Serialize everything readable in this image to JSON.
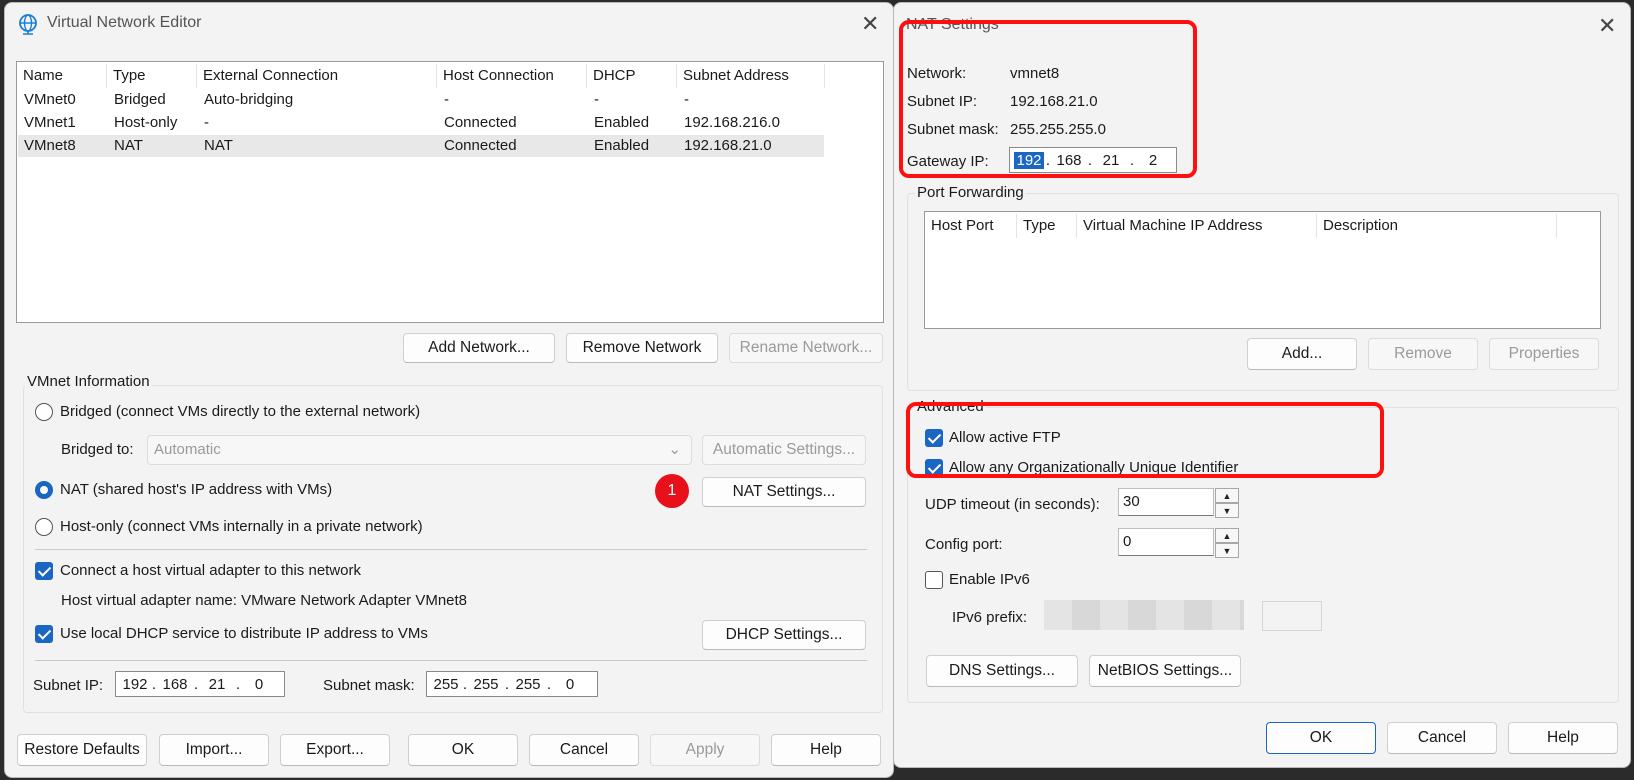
{
  "vne": {
    "title": "Virtual Network Editor",
    "columns": [
      "Name",
      "Type",
      "External Connection",
      "Host Connection",
      "DHCP",
      "Subnet Address"
    ],
    "rows": [
      [
        "VMnet0",
        "Bridged",
        "Auto-bridging",
        "-",
        "-",
        "-"
      ],
      [
        "VMnet1",
        "Host-only",
        "-",
        "Connected",
        "Enabled",
        "192.168.216.0"
      ],
      [
        "VMnet8",
        "NAT",
        "NAT",
        "Connected",
        "Enabled",
        "192.168.21.0"
      ]
    ],
    "add_network": "Add Network...",
    "remove_network": "Remove Network",
    "rename_network": "Rename Network...",
    "vmnet_info": "VMnet Information",
    "bridged_radio": "Bridged (connect VMs directly to the external network)",
    "bridged_to_label": "Bridged to:",
    "bridged_to_value": "Automatic",
    "automatic_settings": "Automatic Settings...",
    "nat_radio": "NAT (shared host's IP address with VMs)",
    "step_badge": "1",
    "nat_settings": "NAT Settings...",
    "hostonly_radio": "Host-only (connect VMs internally in a private network)",
    "connect_adapter": "Connect a host virtual adapter to this network",
    "adapter_name": "Host virtual adapter name: VMware Network Adapter VMnet8",
    "use_dhcp": "Use local DHCP service to distribute IP address to VMs",
    "dhcp_settings": "DHCP Settings...",
    "subnet_ip_label": "Subnet IP:",
    "subnet_ip": [
      "192",
      "168",
      "21",
      "0"
    ],
    "subnet_mask_label": "Subnet mask:",
    "subnet_mask": [
      "255",
      "255",
      "255",
      "0"
    ],
    "restore_defaults": "Restore Defaults",
    "import": "Import...",
    "export": "Export...",
    "ok": "OK",
    "cancel": "Cancel",
    "apply": "Apply",
    "help": "Help"
  },
  "nat": {
    "title": "NAT Settings",
    "network_label": "Network:",
    "network_value": "vmnet8",
    "subnet_ip_label": "Subnet IP:",
    "subnet_ip_value": "192.168.21.0",
    "subnet_mask_label": "Subnet mask:",
    "subnet_mask_value": "255.255.255.0",
    "gateway_label": "Gateway IP:",
    "gateway": [
      "192",
      "168",
      "21",
      "2"
    ],
    "port_forwarding": "Port Forwarding",
    "pf_columns": [
      "Host Port",
      "Type",
      "Virtual Machine IP Address",
      "Description"
    ],
    "add": "Add...",
    "remove": "Remove",
    "properties": "Properties",
    "advanced": "Advanced",
    "allow_ftp": "Allow active FTP",
    "allow_oui": "Allow any Organizationally Unique Identifier",
    "udp_label": "UDP timeout (in seconds):",
    "udp_value": "30",
    "config_port_label": "Config port:",
    "config_port_value": "0",
    "enable_ipv6": "Enable IPv6",
    "ipv6_prefix": "IPv6 prefix:",
    "dns_settings": "DNS Settings...",
    "netbios_settings": "NetBIOS Settings...",
    "ok": "OK",
    "cancel": "Cancel",
    "help": "Help"
  },
  "colors": {
    "accent": "#1a66c2",
    "annotation_red": "#ff1010"
  }
}
